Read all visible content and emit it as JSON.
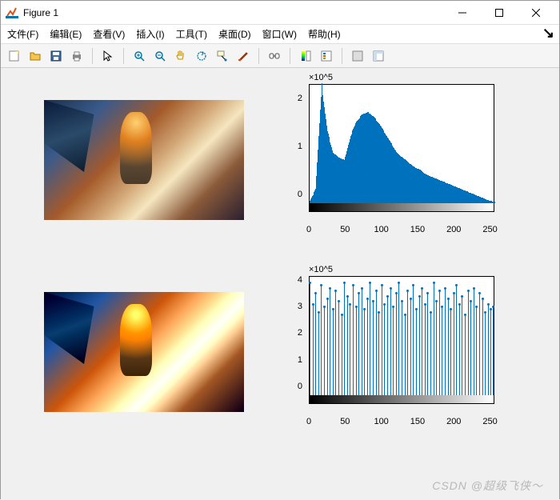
{
  "window": {
    "title": "Figure 1"
  },
  "menu": {
    "file": "文件(F)",
    "edit": "编辑(E)",
    "view": "查看(V)",
    "insert": "插入(I)",
    "tools": "工具(T)",
    "desktop": "桌面(D)",
    "window": "窗口(W)",
    "help": "帮助(H)"
  },
  "watermark": "CSDN @超级飞侠～",
  "chart_data": [
    {
      "type": "bar",
      "name": "top-histogram",
      "title": "",
      "xlabel": "",
      "ylabel": "",
      "y_exponent_label": "×10^5",
      "xlim": [
        0,
        256
      ],
      "ylim": [
        0,
        250000.0
      ],
      "xticks": [
        0,
        50,
        100,
        150,
        200,
        250
      ],
      "yticks": [
        0,
        1,
        2
      ],
      "x": [
        0,
        8,
        16,
        24,
        32,
        40,
        48,
        56,
        64,
        72,
        80,
        88,
        96,
        104,
        112,
        120,
        128,
        136,
        144,
        152,
        160,
        168,
        176,
        184,
        192,
        200,
        208,
        216,
        224,
        232,
        240,
        248,
        255
      ],
      "values": [
        0.05,
        0.3,
        2.5,
        1.5,
        1.05,
        0.95,
        0.9,
        1.4,
        1.7,
        1.85,
        1.9,
        1.8,
        1.65,
        1.45,
        1.25,
        1.05,
        0.95,
        0.85,
        0.75,
        0.7,
        0.6,
        0.55,
        0.5,
        0.45,
        0.4,
        0.35,
        0.3,
        0.25,
        0.2,
        0.15,
        0.1,
        0.05,
        0.03
      ],
      "value_scale": 100000.0,
      "colorbar_under_axis": true
    },
    {
      "type": "stem",
      "name": "bottom-histogram-equalized",
      "title": "",
      "xlabel": "",
      "ylabel": "",
      "y_exponent_label": "×10^5",
      "xlim": [
        0,
        256
      ],
      "ylim": [
        0,
        450000.0
      ],
      "xticks": [
        0,
        50,
        100,
        150,
        200,
        250
      ],
      "yticks": [
        0,
        1,
        2,
        3,
        4
      ],
      "x": [
        0,
        4,
        8,
        12,
        16,
        20,
        24,
        28,
        32,
        36,
        40,
        44,
        48,
        52,
        56,
        60,
        64,
        68,
        72,
        76,
        80,
        84,
        88,
        92,
        96,
        100,
        104,
        108,
        112,
        116,
        120,
        124,
        128,
        132,
        136,
        140,
        144,
        148,
        152,
        156,
        160,
        164,
        168,
        172,
        176,
        180,
        184,
        188,
        192,
        196,
        200,
        204,
        208,
        212,
        216,
        220,
        224,
        228,
        232,
        236,
        240,
        244,
        248,
        252,
        255
      ],
      "values": [
        4.2,
        3.4,
        3.8,
        3.1,
        4.1,
        3.3,
        3.6,
        4.0,
        3.2,
        3.9,
        3.5,
        3.0,
        4.2,
        3.7,
        3.4,
        4.1,
        3.3,
        3.8,
        4.0,
        3.2,
        3.6,
        4.2,
        3.5,
        3.9,
        3.1,
        4.1,
        3.4,
        3.7,
        4.0,
        3.3,
        3.8,
        4.2,
        3.5,
        3.0,
        3.9,
        3.6,
        4.1,
        3.2,
        3.7,
        4.0,
        3.4,
        3.8,
        3.1,
        4.2,
        3.5,
        3.9,
        3.3,
        4.0,
        3.6,
        3.2,
        3.8,
        4.1,
        3.4,
        3.7,
        3.0,
        3.9,
        3.5,
        4.0,
        3.3,
        3.8,
        3.6,
        3.1,
        3.4,
        3.2,
        3.3
      ],
      "value_scale": 100000.0,
      "colorbar_under_axis": true
    }
  ]
}
